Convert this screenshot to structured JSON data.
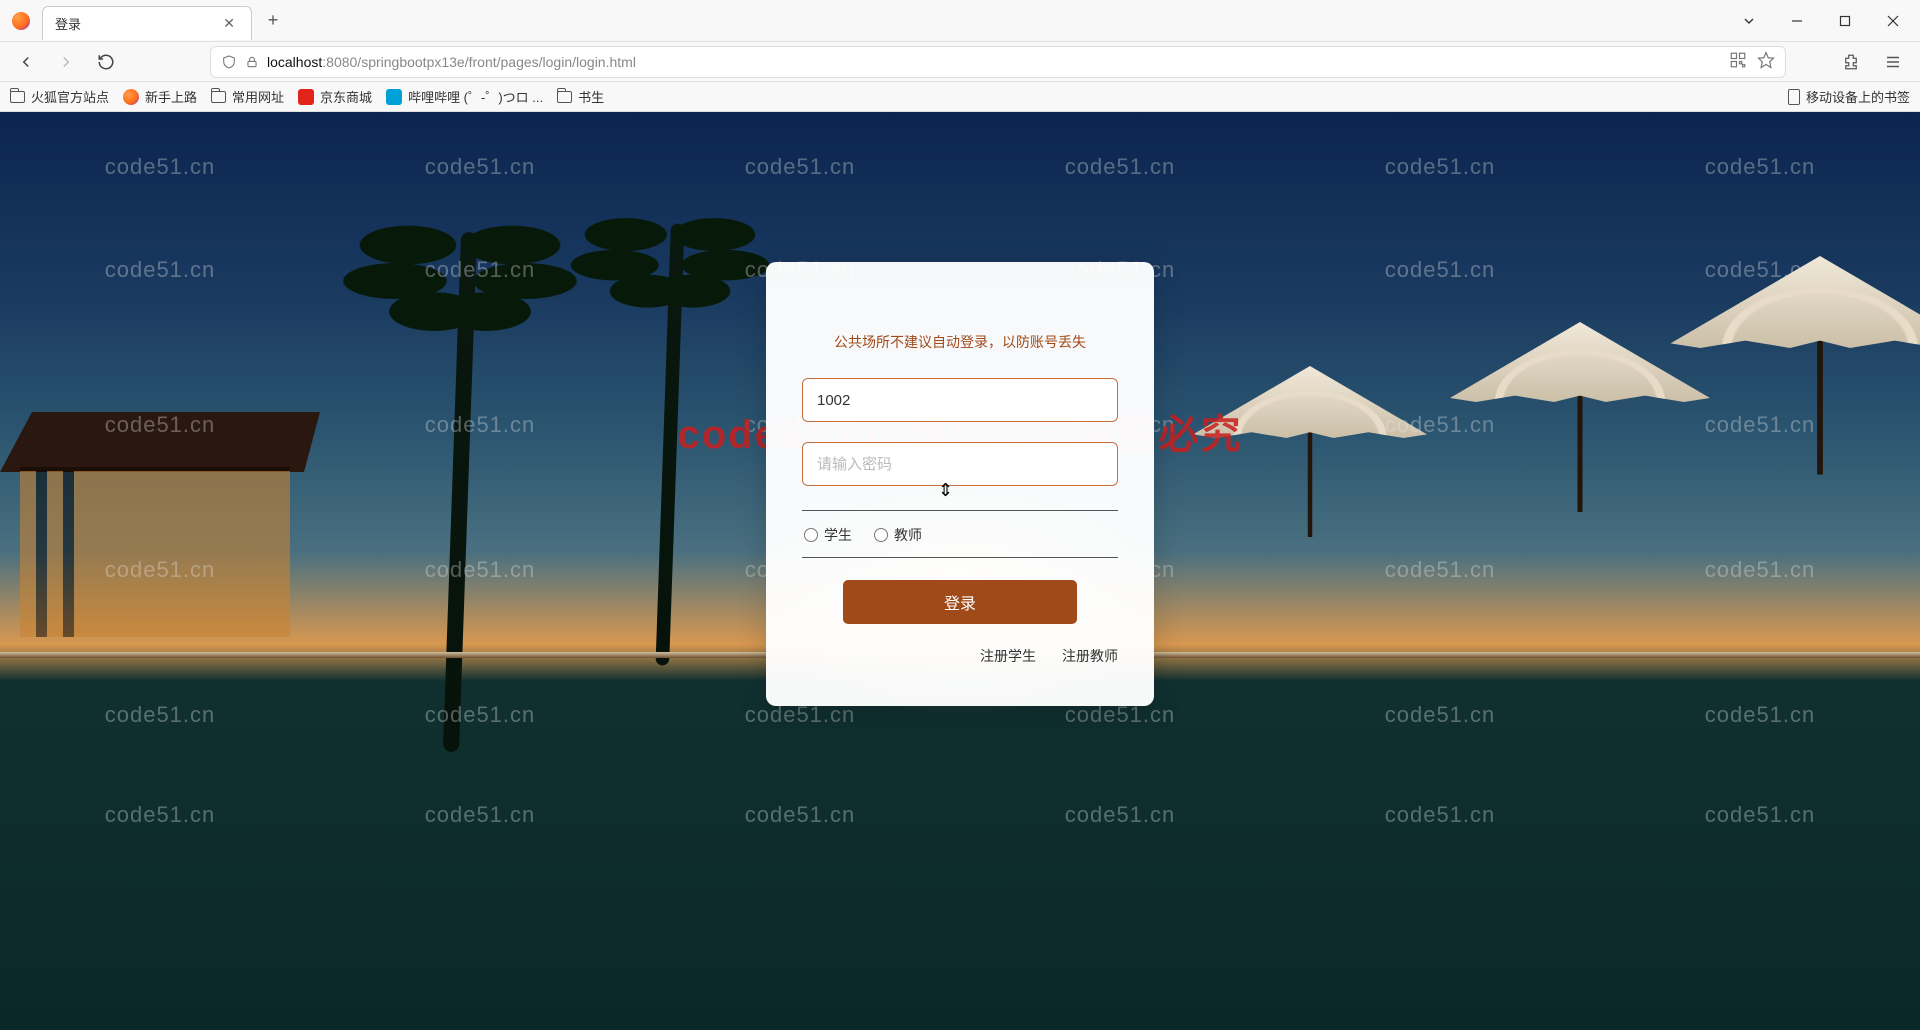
{
  "browser": {
    "tab_title": "登录",
    "new_tab_tooltip": "+",
    "window_controls": {
      "minimize": "–",
      "maximize": "▢",
      "close": "✕"
    }
  },
  "addressbar": {
    "host": "localhost",
    "path": ":8080/springbootpx13e/front/pages/login/login.html"
  },
  "bookmarks": {
    "items": [
      {
        "type": "folder",
        "label": "火狐官方站点"
      },
      {
        "type": "fav-ff",
        "label": "新手上路"
      },
      {
        "type": "folder",
        "label": "常用网址"
      },
      {
        "type": "fav-jd",
        "label": "京东商城"
      },
      {
        "type": "fav-bili",
        "label": "哔哩哔哩 (゜-゜)つロ ..."
      },
      {
        "type": "folder",
        "label": "书生"
      }
    ],
    "mobile_label": "移动设备上的书签"
  },
  "watermark": {
    "small": "code51.cn",
    "big": "code51.cn-源码乐园盗图必究"
  },
  "login": {
    "tip": "公共场所不建议自动登录，以防账号丢失",
    "username_value": "1002",
    "password_placeholder": "请输入密码",
    "role_student": "学生",
    "role_teacher": "教师",
    "submit_label": "登录",
    "register_student": "注册学生",
    "register_teacher": "注册教师"
  },
  "colors": {
    "accent": "#a04a1a",
    "input_border": "#c87040"
  }
}
